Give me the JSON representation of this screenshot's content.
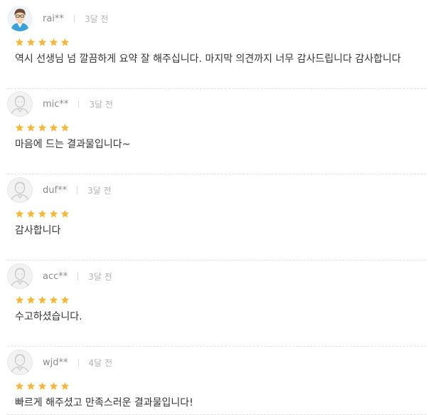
{
  "colors": {
    "star": "#f4b93a",
    "username": "#8a8a8a",
    "date": "#b4b4b4",
    "comment": "#333333",
    "divider": "#e3e3e3"
  },
  "reviews": [
    {
      "avatar": "user-avatar-icon",
      "username": "rai**",
      "date": "3달 전",
      "rating": 5,
      "comment": "역시 선생님 넘 깔끔하게 요약 잘 해주십니다. 마지막 의견까지 너무 감사드립니다 감사합니다"
    },
    {
      "avatar": "default-avatar-icon",
      "username": "mic**",
      "date": "3달 전",
      "rating": 5,
      "comment": "마음에 드는 결과물입니다~"
    },
    {
      "avatar": "default-avatar-icon",
      "username": "duf**",
      "date": "3달 전",
      "rating": 5,
      "comment": "감사합니다"
    },
    {
      "avatar": "default-avatar-icon",
      "username": "acc**",
      "date": "3달 전",
      "rating": 5,
      "comment": "수고하셨습니다."
    },
    {
      "avatar": "default-avatar-icon",
      "username": "wjd**",
      "date": "4달 전",
      "rating": 5,
      "comment": "빠르게 해주셨고 만족스러운 결과물입니다!"
    }
  ]
}
